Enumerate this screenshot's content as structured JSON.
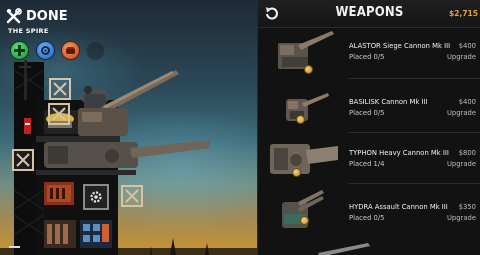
{
  "scene": {
    "done_label": "DONE",
    "level_name": "THE SPIRE",
    "abilities": [
      {
        "name": "repair-ability",
        "color": "#2db84a"
      },
      {
        "name": "shield-ability",
        "color": "#2a7bd8"
      },
      {
        "name": "overdrive-ability",
        "color": "#e06a2c"
      },
      {
        "name": "empty-ability",
        "color": "#1a1a1a"
      }
    ]
  },
  "panel": {
    "title": "WEAPONS",
    "money": "$2,715",
    "weapons": [
      {
        "name": "ALASTOR Siege Cannon Mk III",
        "placed": "Placed 0/5",
        "price": "$400",
        "action": "Upgrade"
      },
      {
        "name": "BASILISK Cannon Mk III",
        "placed": "Placed 0/5",
        "price": "$400",
        "action": "Upgrade"
      },
      {
        "name": "TYPHON Heavy Cannon Mk III",
        "placed": "Placed 1/4",
        "price": "$800",
        "action": "Upgrade"
      },
      {
        "name": "HYDRA Assault Cannon Mk III",
        "placed": "Placed 0/5",
        "price": "$350",
        "action": "Upgrade"
      }
    ]
  },
  "colors": {
    "accent_money": "#e0a040",
    "slot_border": "#d7c3a6",
    "panel_bg": "#121212"
  }
}
